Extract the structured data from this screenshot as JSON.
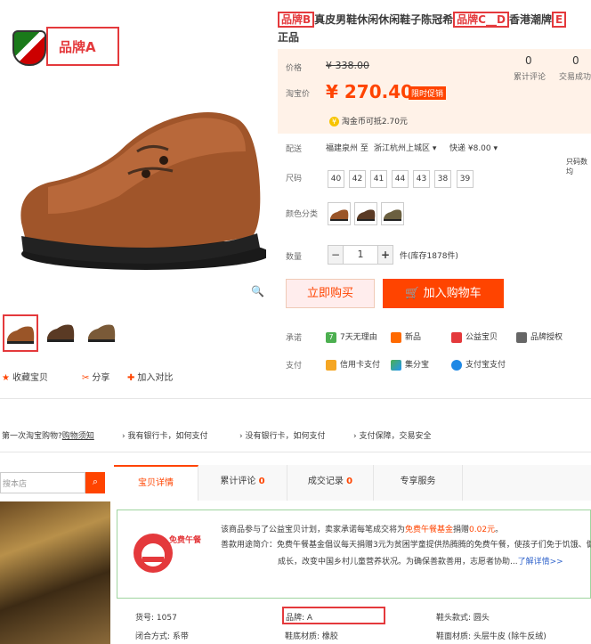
{
  "brand": {
    "logo_text": "品牌A"
  },
  "product": {
    "title_line1_prefix": "",
    "title_brand_b": "品牌B",
    "title_middle": "真皮男鞋休闲休闲鞋子陈冠希",
    "title_brand_cd": "品牌C__D",
    "title_suffix": "香港潮牌",
    "title_brand_e": "E",
    "title_line2": "正品"
  },
  "price": {
    "orig_label": "价格",
    "orig_value": "¥ 338.00",
    "tb_label": "淘宝价",
    "tb_value": "¥ 270.40",
    "promo": "限时促销",
    "coin_text": "淘金币可抵2.70元",
    "reviews_count": "0",
    "reviews_label": "累计评论",
    "deals_count": "0",
    "deals_label": "交易成功"
  },
  "shipping": {
    "label": "配送",
    "from": "福建泉州 至",
    "to": "浙江杭州上城区",
    "method": "快递 ¥8.00",
    "side_note": "只码数均"
  },
  "size": {
    "label": "尺码",
    "options": [
      "40",
      "42",
      "41",
      "44",
      "43",
      "38",
      "39"
    ]
  },
  "color": {
    "label": "颜色分类"
  },
  "quantity": {
    "label": "数量",
    "value": "1",
    "minus": "−",
    "plus": "+",
    "stock": "件(库存1878件)"
  },
  "buttons": {
    "buy_now": "立即购买",
    "add_cart": "加入购物车"
  },
  "promise": {
    "label": "承诺",
    "items": [
      "7天无理由",
      "新品",
      "公益宝贝",
      "品牌授权"
    ]
  },
  "payment": {
    "label": "支付",
    "items": [
      "信用卡支付",
      "集分宝",
      "支付宝支付"
    ]
  },
  "gallery_actions": {
    "favorite": "收藏宝贝",
    "share": "分享",
    "compare": "加入对比"
  },
  "guide": {
    "first_time": "第一次淘宝购物?",
    "shopping_guide": "购物须知",
    "no_bank": "我有银行卡，如何支付",
    "no_bank2": "没有银行卡，如何支付",
    "safe": "支付保障，交易安全"
  },
  "store": {
    "search_placeholder": "搜本店"
  },
  "tabs": [
    {
      "label": "宝贝详情",
      "count": ""
    },
    {
      "label": "累计评论",
      "count": "0"
    },
    {
      "label": "成交记录",
      "count": "0"
    },
    {
      "label": "专享服务",
      "count": ""
    }
  ],
  "charity": {
    "logo_text": "免费午餐",
    "line1_a": "该商品参与了公益宝贝计划，卖家承诺每笔成交将为",
    "line1_fund": "免费午餐基金",
    "line1_b": "捐赠",
    "line1_amount": "0.02元",
    "line1_end": "。",
    "line2": "善款用途简介：免费午餐基金倡议每天捐赠3元为贫困学童提供热腾腾的免费午餐，使孩子们免于饥饿、健",
    "line3_a": "成长，改变中国乡村儿童营养状况。为确保善款善用，志愿者协助...",
    "line3_link": "了解详情>>"
  },
  "specs": {
    "item_no": "货号: 1057",
    "brand_label": "品牌:",
    "brand_value": "A",
    "toe": "鞋头款式: 圆头",
    "closure": "闭合方式: 系带",
    "sole": "鞋底材质: 橡胶",
    "upper": "鞋面材质: 头层牛皮 (除牛反绒)"
  }
}
